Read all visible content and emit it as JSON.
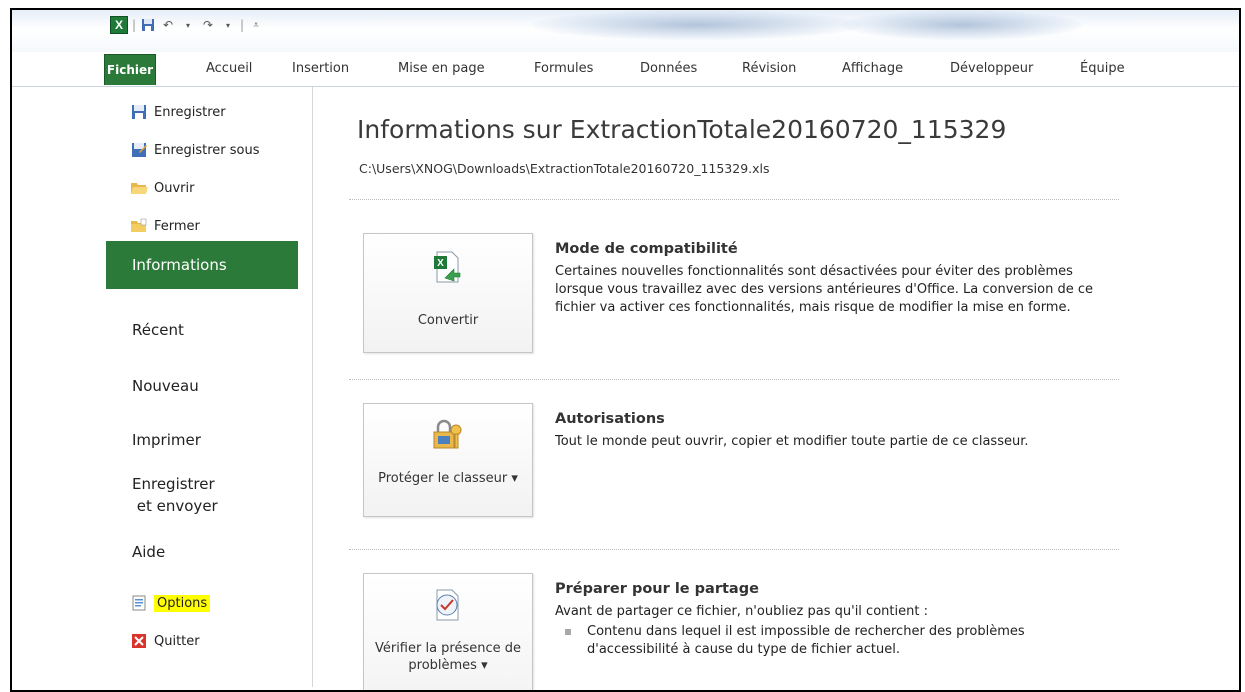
{
  "quick_access": {
    "app_icon": "excel-logo-icon",
    "icons": [
      "save-icon",
      "undo-icon",
      "redo-icon",
      "customize-icon"
    ]
  },
  "tabs": [
    "Fichier",
    "Accueil",
    "Insertion",
    "Mise en page",
    "Formules",
    "Données",
    "Révision",
    "Affichage",
    "Développeur",
    "Équipe"
  ],
  "nav": {
    "small_top": [
      {
        "label": "Enregistrer",
        "icon": "save-icon"
      },
      {
        "label": "Enregistrer sous",
        "icon": "save-as-icon"
      },
      {
        "label": "Ouvrir",
        "icon": "open-folder-icon"
      },
      {
        "label": "Fermer",
        "icon": "close-folder-icon"
      }
    ],
    "active": "Informations",
    "big": [
      "Récent",
      "Nouveau",
      "Imprimer",
      "Enregistrer\n et envoyer",
      "Aide"
    ],
    "small_bottom": [
      {
        "label": "Options",
        "icon": "options-icon",
        "highlighted": true
      },
      {
        "label": "Quitter",
        "icon": "exit-icon"
      }
    ]
  },
  "main": {
    "title": "Informations sur ExtractionTotale20160720_115329",
    "path": "C:\\Users\\XNOG\\Downloads\\ExtractionTotale20160720_115329.xls",
    "sections": [
      {
        "button": "Convertir",
        "icon": "convert-icon",
        "title": "Mode de compatibilité",
        "text": "Certaines nouvelles fonctionnalités sont désactivées pour éviter des problèmes lorsque vous travaillez avec des versions antérieures d'Office. La conversion de ce fichier va activer ces fonctionnalités, mais risque de modifier la mise en forme."
      },
      {
        "button": "Protéger le classeur ▾",
        "icon": "protect-lock-icon",
        "title": "Autorisations",
        "text": "Tout le monde peut ouvrir, copier et modifier toute partie de ce classeur."
      },
      {
        "button": "Vérifier la présence de problèmes ▾",
        "icon": "check-document-icon",
        "title": "Préparer pour le partage",
        "text": "Avant de partager ce fichier, n'oubliez pas qu'il contient :",
        "bullets": [
          "Contenu dans lequel il est impossible de rechercher des problèmes d'accessibilité à cause du type de fichier actuel."
        ]
      }
    ]
  }
}
